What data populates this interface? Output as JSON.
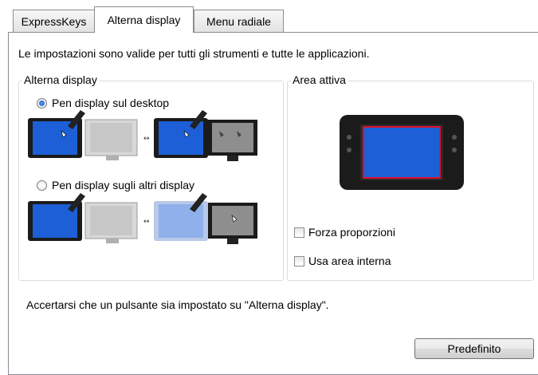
{
  "tabs": [
    {
      "label": "ExpressKeys",
      "active": false
    },
    {
      "label": "Alterna display",
      "active": true
    },
    {
      "label": "Menu radiale",
      "active": false
    }
  ],
  "info_text": "Le impostazioni sono valide per tutti gli strumenti e tutte le applicazioni.",
  "toggle_group": {
    "title": "Alterna display",
    "options": [
      {
        "label": "Pen display sul desktop",
        "selected": true
      },
      {
        "label": "Pen display sugli altri display",
        "selected": false
      }
    ]
  },
  "active_area": {
    "title": "Area attiva",
    "checkboxes": [
      {
        "label": "Forza proporzioni",
        "checked": false
      },
      {
        "label": "Usa area interna",
        "checked": false
      }
    ]
  },
  "note": "Accertarsi che un pulsante sia impostato su \"Alterna display\".",
  "default_button": "Predefinito",
  "colors": {
    "accent_blue": "#1d5fd6",
    "active_area_outline": "#e0102a",
    "tablet_body": "#1b1b1b"
  }
}
